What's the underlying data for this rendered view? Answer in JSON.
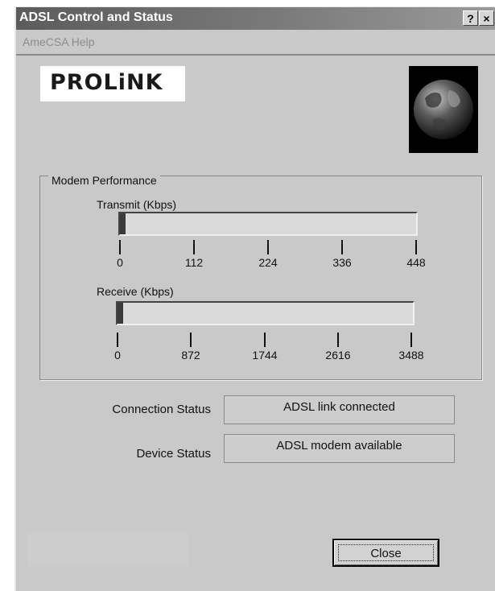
{
  "window": {
    "title": "ADSL Control and Status",
    "help_button": "?",
    "close_button": "×"
  },
  "menu": {
    "items": [
      "AmeCSA Help"
    ]
  },
  "logo": {
    "text": "PROLiNK"
  },
  "performance": {
    "group_label": "Modem Performance",
    "transmit": {
      "label": "Transmit (Kbps)",
      "ticks": [
        "0",
        "112",
        "224",
        "336",
        "448"
      ],
      "level_fraction": 0.02
    },
    "receive": {
      "label": "Receive (Kbps)",
      "ticks": [
        "0",
        "872",
        "1744",
        "2616",
        "3488"
      ],
      "level_fraction": 0.02
    }
  },
  "status": {
    "connection_label": "Connection Status",
    "connection_value": "ADSL link connected",
    "device_label": "Device Status",
    "device_value": "ADSL modem available"
  },
  "buttons": {
    "close_label": "Close"
  }
}
